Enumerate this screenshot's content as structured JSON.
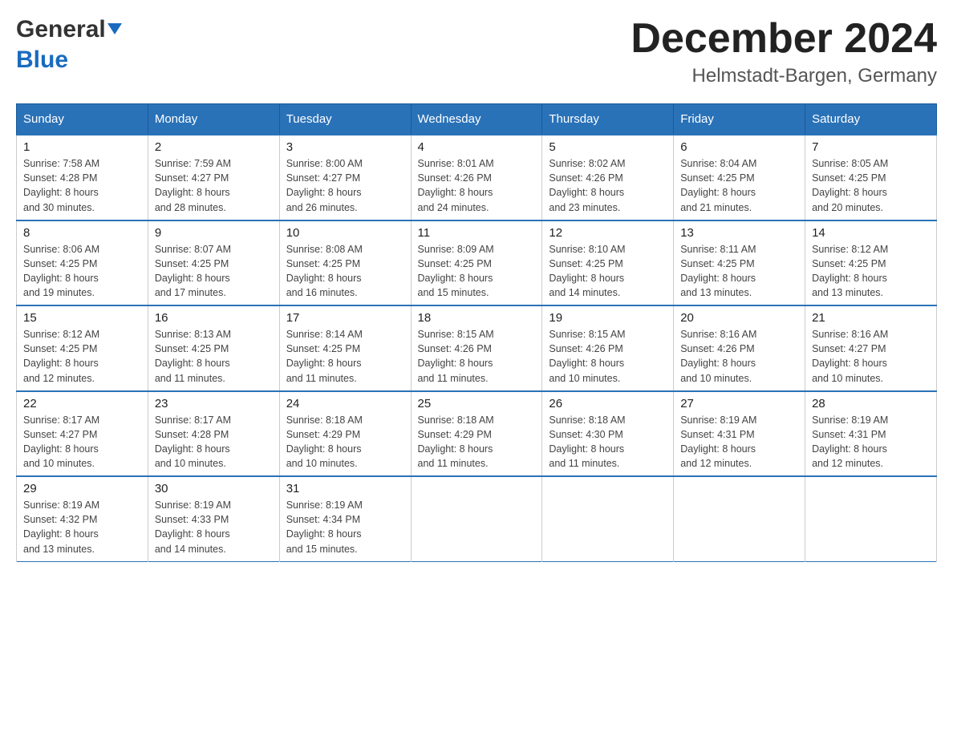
{
  "header": {
    "logo_general": "General",
    "logo_blue": "Blue",
    "month_title": "December 2024",
    "location": "Helmstadt-Bargen, Germany"
  },
  "days_of_week": [
    "Sunday",
    "Monday",
    "Tuesday",
    "Wednesday",
    "Thursday",
    "Friday",
    "Saturday"
  ],
  "weeks": [
    [
      {
        "day": "1",
        "sunrise": "7:58 AM",
        "sunset": "4:28 PM",
        "daylight": "8 hours and 30 minutes."
      },
      {
        "day": "2",
        "sunrise": "7:59 AM",
        "sunset": "4:27 PM",
        "daylight": "8 hours and 28 minutes."
      },
      {
        "day": "3",
        "sunrise": "8:00 AM",
        "sunset": "4:27 PM",
        "daylight": "8 hours and 26 minutes."
      },
      {
        "day": "4",
        "sunrise": "8:01 AM",
        "sunset": "4:26 PM",
        "daylight": "8 hours and 24 minutes."
      },
      {
        "day": "5",
        "sunrise": "8:02 AM",
        "sunset": "4:26 PM",
        "daylight": "8 hours and 23 minutes."
      },
      {
        "day": "6",
        "sunrise": "8:04 AM",
        "sunset": "4:25 PM",
        "daylight": "8 hours and 21 minutes."
      },
      {
        "day": "7",
        "sunrise": "8:05 AM",
        "sunset": "4:25 PM",
        "daylight": "8 hours and 20 minutes."
      }
    ],
    [
      {
        "day": "8",
        "sunrise": "8:06 AM",
        "sunset": "4:25 PM",
        "daylight": "8 hours and 19 minutes."
      },
      {
        "day": "9",
        "sunrise": "8:07 AM",
        "sunset": "4:25 PM",
        "daylight": "8 hours and 17 minutes."
      },
      {
        "day": "10",
        "sunrise": "8:08 AM",
        "sunset": "4:25 PM",
        "daylight": "8 hours and 16 minutes."
      },
      {
        "day": "11",
        "sunrise": "8:09 AM",
        "sunset": "4:25 PM",
        "daylight": "8 hours and 15 minutes."
      },
      {
        "day": "12",
        "sunrise": "8:10 AM",
        "sunset": "4:25 PM",
        "daylight": "8 hours and 14 minutes."
      },
      {
        "day": "13",
        "sunrise": "8:11 AM",
        "sunset": "4:25 PM",
        "daylight": "8 hours and 13 minutes."
      },
      {
        "day": "14",
        "sunrise": "8:12 AM",
        "sunset": "4:25 PM",
        "daylight": "8 hours and 13 minutes."
      }
    ],
    [
      {
        "day": "15",
        "sunrise": "8:12 AM",
        "sunset": "4:25 PM",
        "daylight": "8 hours and 12 minutes."
      },
      {
        "day": "16",
        "sunrise": "8:13 AM",
        "sunset": "4:25 PM",
        "daylight": "8 hours and 11 minutes."
      },
      {
        "day": "17",
        "sunrise": "8:14 AM",
        "sunset": "4:25 PM",
        "daylight": "8 hours and 11 minutes."
      },
      {
        "day": "18",
        "sunrise": "8:15 AM",
        "sunset": "4:26 PM",
        "daylight": "8 hours and 11 minutes."
      },
      {
        "day": "19",
        "sunrise": "8:15 AM",
        "sunset": "4:26 PM",
        "daylight": "8 hours and 10 minutes."
      },
      {
        "day": "20",
        "sunrise": "8:16 AM",
        "sunset": "4:26 PM",
        "daylight": "8 hours and 10 minutes."
      },
      {
        "day": "21",
        "sunrise": "8:16 AM",
        "sunset": "4:27 PM",
        "daylight": "8 hours and 10 minutes."
      }
    ],
    [
      {
        "day": "22",
        "sunrise": "8:17 AM",
        "sunset": "4:27 PM",
        "daylight": "8 hours and 10 minutes."
      },
      {
        "day": "23",
        "sunrise": "8:17 AM",
        "sunset": "4:28 PM",
        "daylight": "8 hours and 10 minutes."
      },
      {
        "day": "24",
        "sunrise": "8:18 AM",
        "sunset": "4:29 PM",
        "daylight": "8 hours and 10 minutes."
      },
      {
        "day": "25",
        "sunrise": "8:18 AM",
        "sunset": "4:29 PM",
        "daylight": "8 hours and 11 minutes."
      },
      {
        "day": "26",
        "sunrise": "8:18 AM",
        "sunset": "4:30 PM",
        "daylight": "8 hours and 11 minutes."
      },
      {
        "day": "27",
        "sunrise": "8:19 AM",
        "sunset": "4:31 PM",
        "daylight": "8 hours and 12 minutes."
      },
      {
        "day": "28",
        "sunrise": "8:19 AM",
        "sunset": "4:31 PM",
        "daylight": "8 hours and 12 minutes."
      }
    ],
    [
      {
        "day": "29",
        "sunrise": "8:19 AM",
        "sunset": "4:32 PM",
        "daylight": "8 hours and 13 minutes."
      },
      {
        "day": "30",
        "sunrise": "8:19 AM",
        "sunset": "4:33 PM",
        "daylight": "8 hours and 14 minutes."
      },
      {
        "day": "31",
        "sunrise": "8:19 AM",
        "sunset": "4:34 PM",
        "daylight": "8 hours and 15 minutes."
      },
      null,
      null,
      null,
      null
    ]
  ],
  "labels": {
    "sunrise": "Sunrise:",
    "sunset": "Sunset:",
    "daylight": "Daylight:"
  }
}
